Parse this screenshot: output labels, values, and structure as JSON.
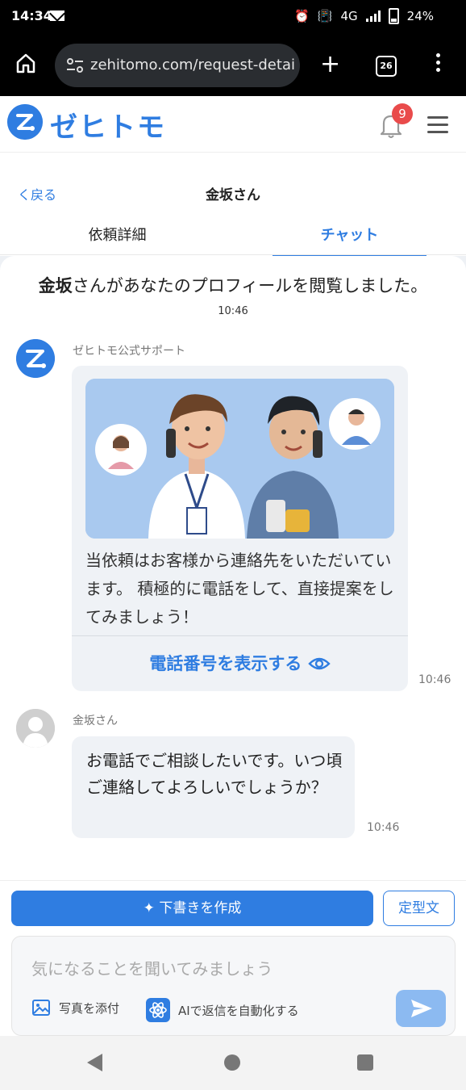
{
  "status_bar": {
    "time": "14:34",
    "network": "4G",
    "battery": "24%"
  },
  "browser": {
    "url": "zehitomo.com/request-detail/",
    "tab_count": "26",
    "new_tab_label": "+"
  },
  "site": {
    "logo_text": "ゼヒトモ",
    "notification_count": "9"
  },
  "chat_header": {
    "back_label": "く戻る",
    "title": "金坂さん"
  },
  "tabs": [
    {
      "label": "依頼詳細",
      "active": false
    },
    {
      "label": "チャット",
      "active": true
    }
  ],
  "messages": {
    "system_name": "金坂",
    "system_text": "さんがあなたのプロフィールを閲覧しました。",
    "system_time": "10:46",
    "support_sender": "ゼヒトモ公式サポート",
    "support_text": "当依頼はお客様から連絡先をいただいています。 積極的に電話をして、直接提案をしてみましょう！",
    "support_action": "電話番号を表示する",
    "support_time": "10:46",
    "user_sender": "金坂さん",
    "user_text": "お電話でご相談したいです。いつ頃ご連絡してよろしいでしょうか？",
    "user_time": "10:46"
  },
  "compose": {
    "draft_button": "下書きを作成",
    "draft_icon": "✦",
    "template_button": "定型文",
    "placeholder": "気になることを聞いてみましょう",
    "attach_label": "写真を添付",
    "ai_label": "AIで返信を自動化する"
  },
  "colors": {
    "accent": "#2f7de1",
    "badge": "#e94b4b",
    "bubble": "#eff2f6"
  }
}
